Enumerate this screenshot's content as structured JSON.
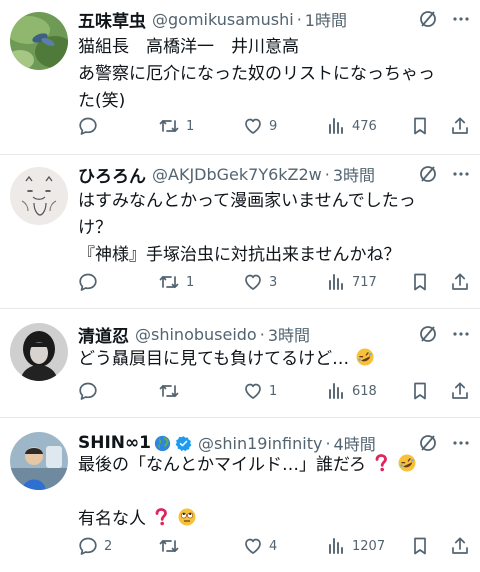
{
  "tweets": [
    {
      "name": "五味草虫",
      "handle": "@gomikusamushi",
      "time": "1時間",
      "lines": [
        "猫組長　高橋洋一　井川意高",
        "あ警察に厄介になった奴のリストになっちゃっ",
        "た(笑)"
      ],
      "reply_count": "",
      "retweet_count": "1",
      "like_count": "9",
      "view_count": "476"
    },
    {
      "name": "ひろろん",
      "handle": "@AKJDbGek7Y6kZ2w",
      "time": "3時間",
      "lines": [
        "はすみなんとかって漫画家いませんでしたっ",
        "け？",
        "『神様』手塚治虫に対抗出来ませんかね？"
      ],
      "reply_count": "",
      "retweet_count": "1",
      "like_count": "3",
      "view_count": "717"
    },
    {
      "name": "清道忍",
      "handle": "@shinobuseido",
      "time": "3時間",
      "lines": [
        "どう贔屓目に見ても負けてるけど…"
      ],
      "reply_count": "",
      "retweet_count": "",
      "like_count": "1",
      "view_count": "618"
    },
    {
      "name": "SHIN∞1",
      "handle": "@shin19infinity",
      "time": "4時間",
      "lines": [
        "最後の「なんとかマイルド…」誰だろ",
        "有名な人"
      ],
      "reply_count": "2",
      "retweet_count": "",
      "like_count": "4",
      "view_count": "1207"
    }
  ],
  "time_separator": "·",
  "colors": {
    "text": "#0f1419",
    "muted": "#536471",
    "verified": "#1d9bf0",
    "divider": "#e6e9eb"
  }
}
